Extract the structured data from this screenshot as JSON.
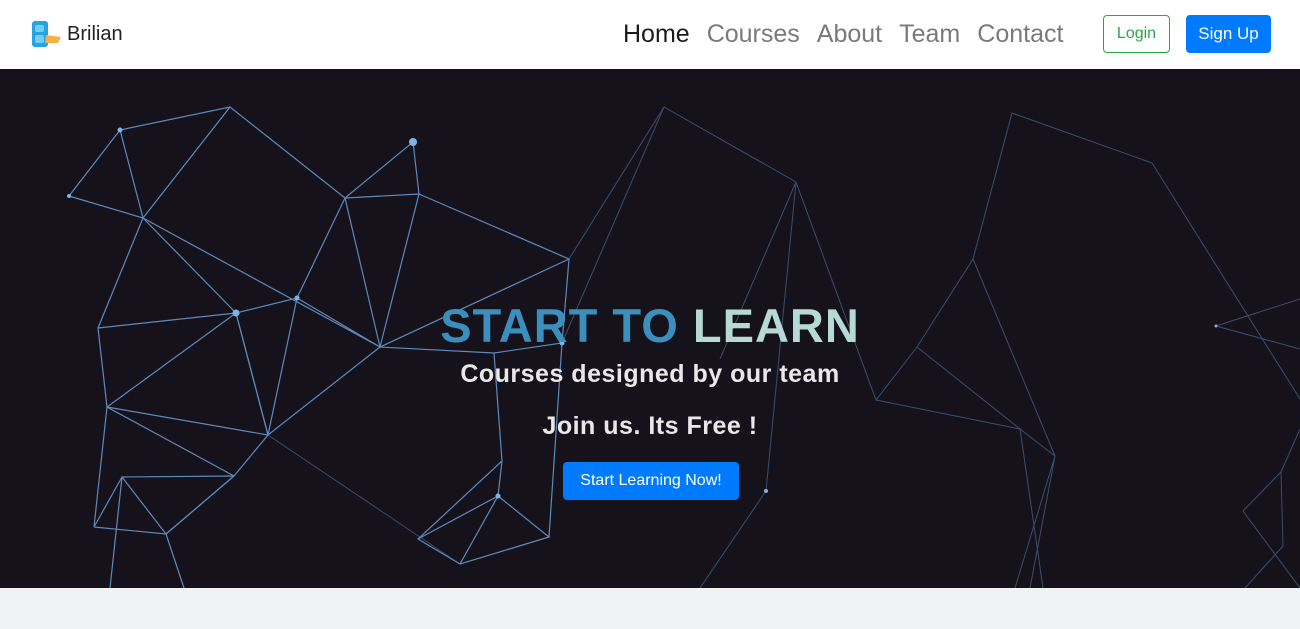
{
  "brand": {
    "name": "Brilian",
    "logo": "brilian-b-logo-icon"
  },
  "nav": {
    "links": [
      {
        "label": "Home",
        "active": true
      },
      {
        "label": "Courses",
        "active": false
      },
      {
        "label": "About",
        "active": false
      },
      {
        "label": "Team",
        "active": false
      },
      {
        "label": "Contact",
        "active": false
      }
    ],
    "login_label": "Login",
    "signup_label": "Sign Up"
  },
  "hero": {
    "headline_part1": "START TO",
    "headline_part2": "LEARN",
    "subtitle": "Courses designed by our team",
    "tagline": "Join us. Its Free !",
    "cta_label": "Start Learning Now!",
    "background_icon": "network-mesh-graphic"
  },
  "colors": {
    "primary": "#007bff",
    "success": "#28a745",
    "hero_bg": "#16121c",
    "headline_blue": "#3b8fbd",
    "headline_light": "#b7d9d6",
    "mesh_line": "#6a9fd6"
  }
}
